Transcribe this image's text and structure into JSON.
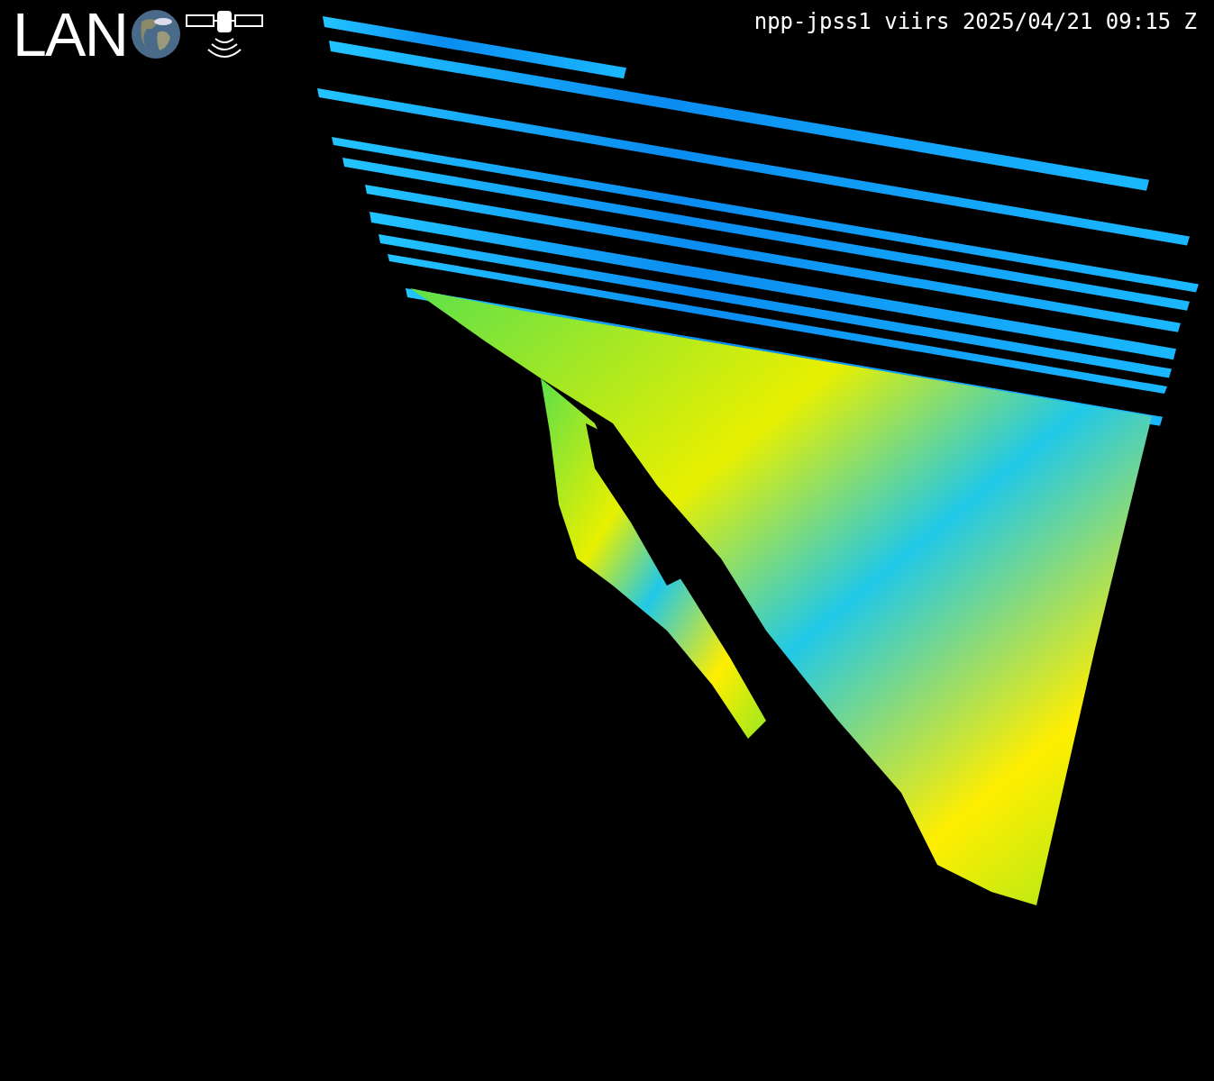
{
  "logo": {
    "text": "LAN"
  },
  "header": {
    "caption": "npp-jpss1 viirs 2025/04/21 09:15 Z"
  }
}
